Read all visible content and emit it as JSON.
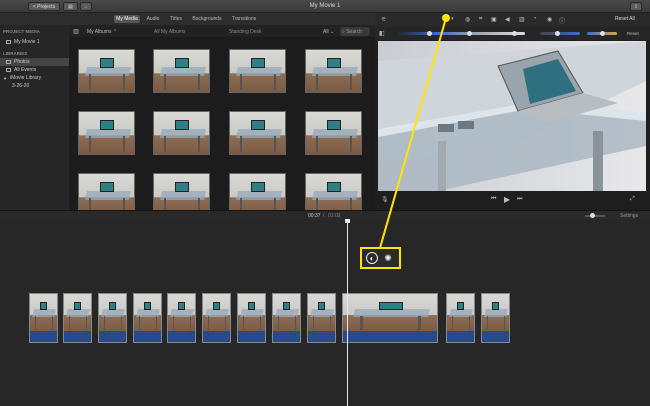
{
  "window": {
    "title": "My Movie 1"
  },
  "titlebar": {
    "projects_label": "< Projects"
  },
  "media_tabs": [
    {
      "label": "My Media",
      "active": true
    },
    {
      "label": "Audio",
      "active": false
    },
    {
      "label": "Titles",
      "active": false
    },
    {
      "label": "Backgrounds",
      "active": false
    },
    {
      "label": "Transitions",
      "active": false
    }
  ],
  "sidebar": {
    "project_media_header": "PROJECT MEDIA",
    "project_item": "My Movie 1",
    "libraries_header": "LIBRARIES",
    "items": [
      {
        "label": "Photos",
        "selected": true,
        "icon": "photos-icon"
      },
      {
        "label": "All Events",
        "selected": false,
        "icon": "events-icon"
      },
      {
        "label": "iMovie Library",
        "selected": false,
        "icon": "disclosure-icon"
      },
      {
        "label": "3-26-20",
        "selected": false,
        "icon": ""
      }
    ]
  },
  "browser": {
    "album_select": "My Albums",
    "crumb1": "All My Albums",
    "crumb2": "Standing Desk",
    "filter": "All",
    "search_placeholder": "Search"
  },
  "viewer": {
    "reset_all": "Reset All",
    "reset": "Reset"
  },
  "timeline": {
    "current_time": "00:37",
    "total_time": "01:02",
    "settings_label": "Settings"
  },
  "colors": {
    "callout": "#ffe500",
    "audio": "#284a88",
    "accent": "#3f7fd9"
  }
}
